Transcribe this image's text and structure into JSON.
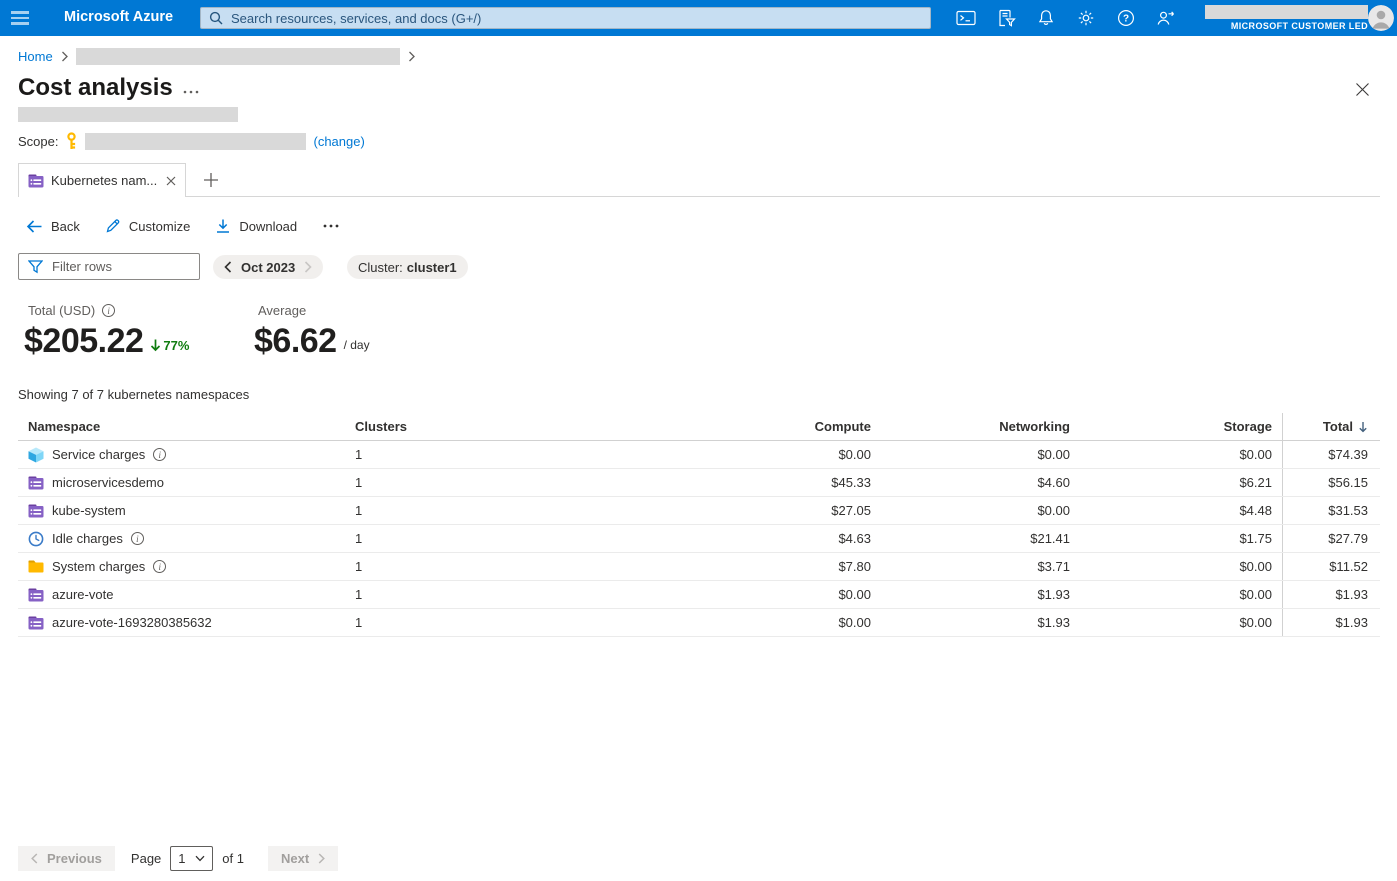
{
  "topbar": {
    "brand": "Microsoft Azure",
    "search_placeholder": "Search resources, services, and docs (G+/)",
    "account_label": "MICROSOFT CUSTOMER LED",
    "icons": [
      "hamburger-icon",
      "search-icon",
      "cloud-shell-icon",
      "directory-filter-icon",
      "notifications-bell-icon",
      "settings-gear-icon",
      "help-icon",
      "feedback-icon",
      "avatar"
    ]
  },
  "breadcrumb": {
    "home": "Home"
  },
  "page": {
    "title": "Cost analysis",
    "scope_label": "Scope:",
    "change_link": "(change)"
  },
  "tabs": {
    "active": "Kubernetes nam...",
    "icon": "namespace-icon"
  },
  "toolbar": {
    "back": "Back",
    "customize": "Customize",
    "download": "Download"
  },
  "filters": {
    "placeholder": "Filter rows",
    "period": "Oct 2023",
    "cluster_label": "Cluster:",
    "cluster_value": "cluster1"
  },
  "kpis": {
    "total_label": "Total (USD)",
    "total_value": "$205.22",
    "total_change": "77%",
    "total_change_direction": "down",
    "average_label": "Average",
    "average_value": "$6.62",
    "average_unit": "/ day"
  },
  "summary": "Showing 7 of 7 kubernetes namespaces",
  "table": {
    "columns": {
      "namespace": "Namespace",
      "clusters": "Clusters",
      "compute": "Compute",
      "networking": "Networking",
      "storage": "Storage",
      "total": "Total"
    },
    "sort": {
      "column": "Total",
      "direction": "desc"
    },
    "rows": [
      {
        "name": "Service charges",
        "icon": "cube-icon",
        "info": true,
        "clusters": "1",
        "compute": "$0.00",
        "networking": "$0.00",
        "storage": "$0.00",
        "total": "$74.39"
      },
      {
        "name": "microservicesdemo",
        "icon": "namespace-icon",
        "info": false,
        "clusters": "1",
        "compute": "$45.33",
        "networking": "$4.60",
        "storage": "$6.21",
        "total": "$56.15"
      },
      {
        "name": "kube-system",
        "icon": "namespace-icon",
        "info": false,
        "clusters": "1",
        "compute": "$27.05",
        "networking": "$0.00",
        "storage": "$4.48",
        "total": "$31.53"
      },
      {
        "name": "Idle charges",
        "icon": "clock-icon",
        "info": true,
        "clusters": "1",
        "compute": "$4.63",
        "networking": "$21.41",
        "storage": "$1.75",
        "total": "$27.79"
      },
      {
        "name": "System charges",
        "icon": "folder-icon",
        "info": true,
        "clusters": "1",
        "compute": "$7.80",
        "networking": "$3.71",
        "storage": "$0.00",
        "total": "$11.52"
      },
      {
        "name": "azure-vote",
        "icon": "namespace-icon",
        "info": false,
        "clusters": "1",
        "compute": "$0.00",
        "networking": "$1.93",
        "storage": "$0.00",
        "total": "$1.93"
      },
      {
        "name": "azure-vote-1693280385632",
        "icon": "namespace-icon",
        "info": false,
        "clusters": "1",
        "compute": "$0.00",
        "networking": "$1.93",
        "storage": "$0.00",
        "total": "$1.93"
      }
    ]
  },
  "pagination": {
    "previous": "Previous",
    "page_label": "Page",
    "page_value": "1",
    "of_label": "of 1",
    "next": "Next"
  },
  "colors": {
    "accent": "#0078d4",
    "decrease_green": "#107c10",
    "namespace_purple": "#8661c5",
    "folder_amber": "#ffb900"
  }
}
